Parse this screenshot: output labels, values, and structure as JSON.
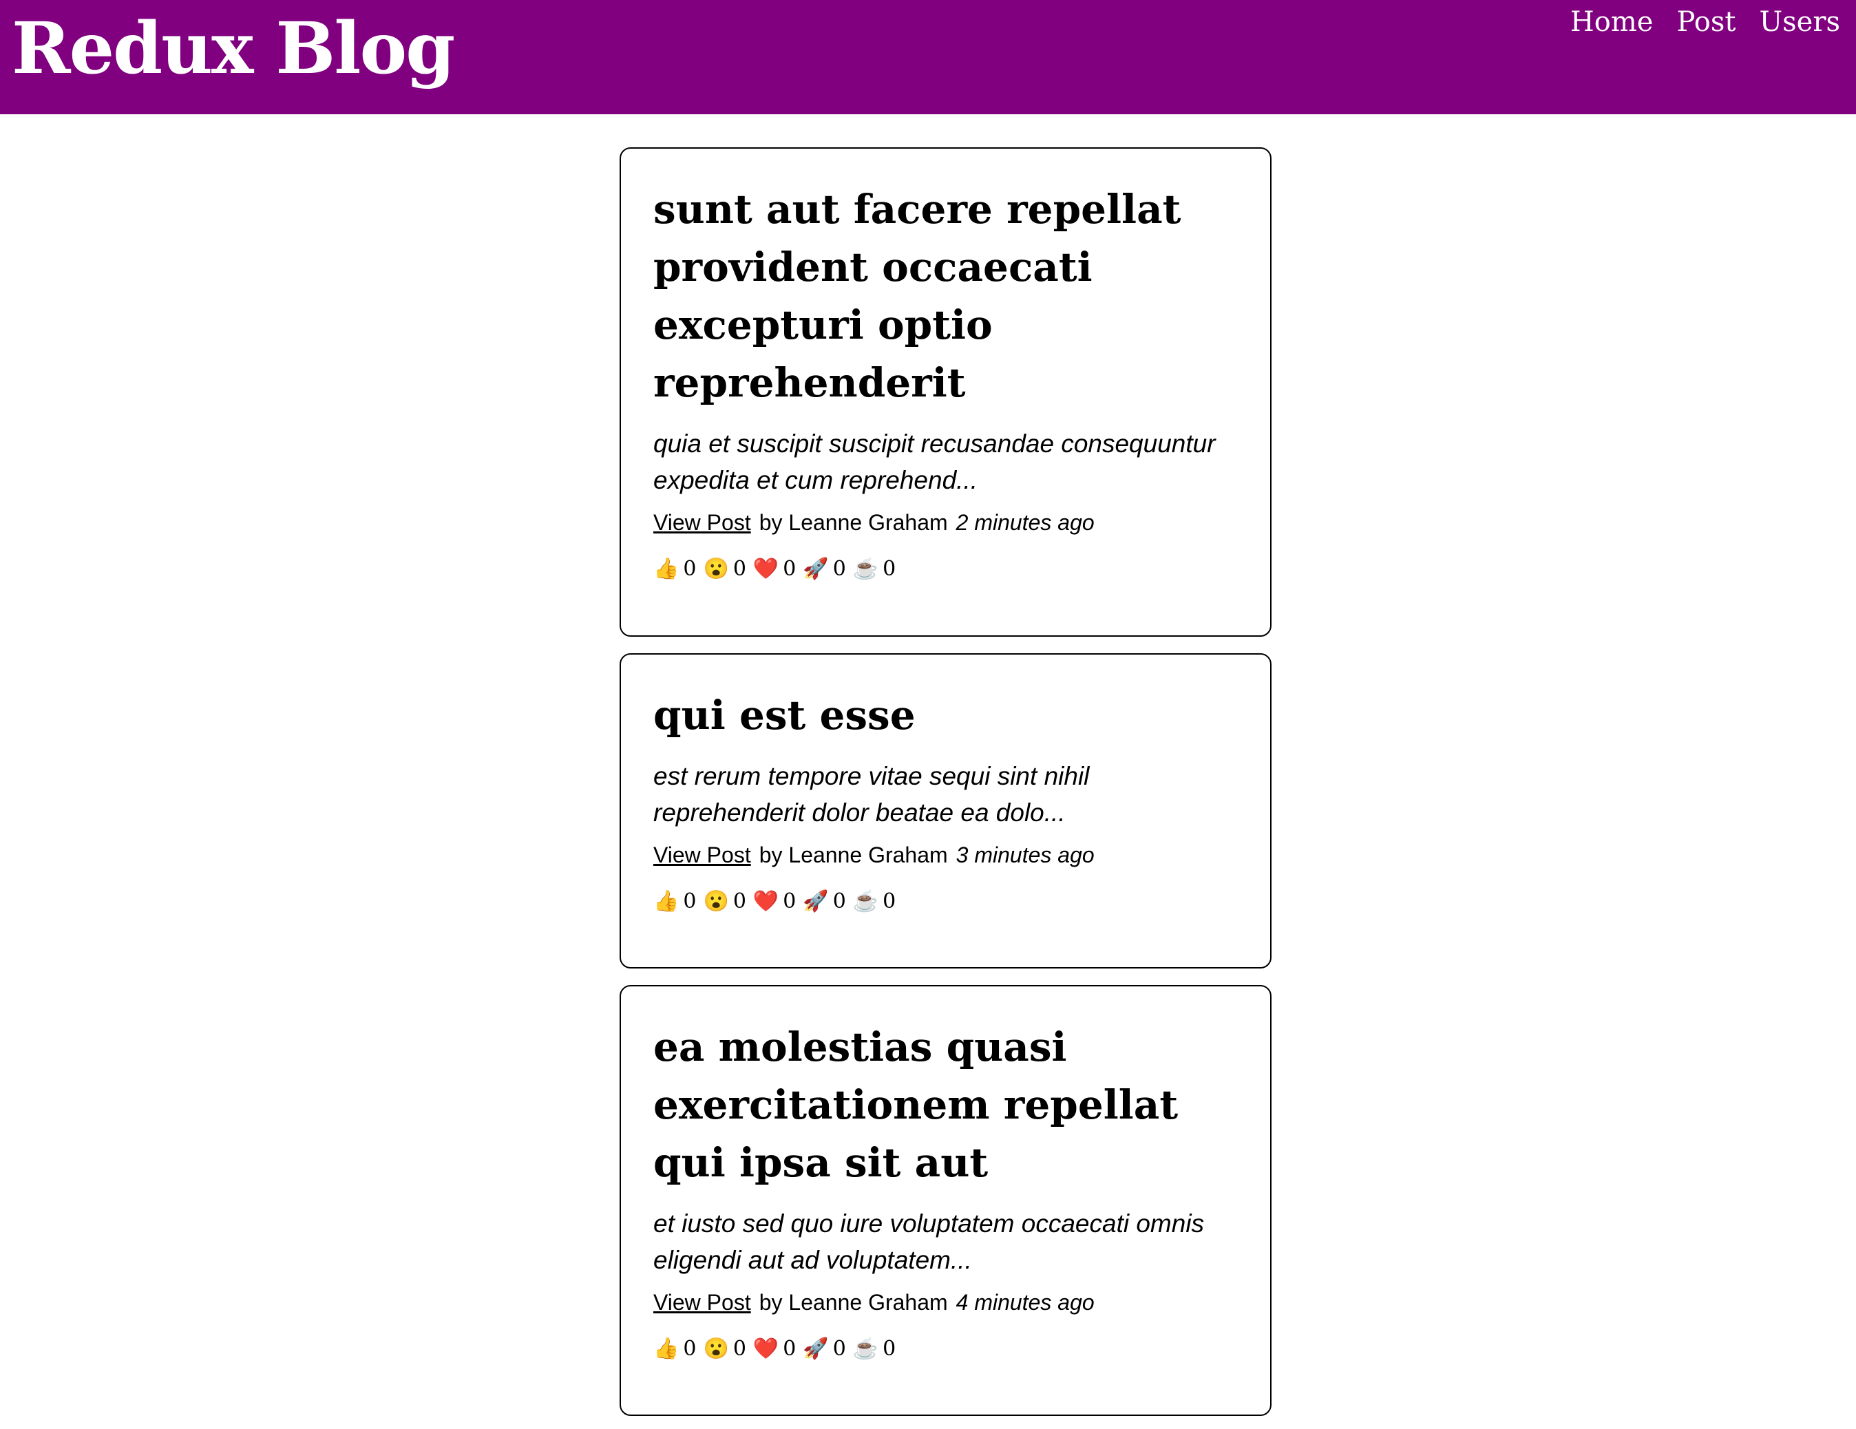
{
  "header": {
    "title": "Redux Blog",
    "nav": [
      "Home",
      "Post",
      "Users"
    ]
  },
  "posts": [
    {
      "title": "sunt aut facere repellat provident occaecati excepturi optio reprehenderit",
      "excerpt": "quia et suscipit suscipit recusandae consequuntur expedita et cum reprehend...",
      "link_label": "View Post",
      "author": "by Leanne Graham",
      "time": "2 minutes ago",
      "reactions": [
        {
          "icon": "thumbs-up",
          "emoji": "👍",
          "count": "0"
        },
        {
          "icon": "wow-face",
          "emoji": "😮",
          "count": "0"
        },
        {
          "icon": "heart",
          "emoji": "❤️",
          "count": "0"
        },
        {
          "icon": "rocket",
          "emoji": "🚀",
          "count": "0"
        },
        {
          "icon": "coffee",
          "emoji": "☕",
          "count": "0"
        }
      ]
    },
    {
      "title": "qui est esse",
      "excerpt": "est rerum tempore vitae sequi sint nihil reprehenderit dolor beatae ea dolo...",
      "link_label": "View Post",
      "author": "by Leanne Graham",
      "time": "3 minutes ago",
      "reactions": [
        {
          "icon": "thumbs-up",
          "emoji": "👍",
          "count": "0"
        },
        {
          "icon": "wow-face",
          "emoji": "😮",
          "count": "0"
        },
        {
          "icon": "heart",
          "emoji": "❤️",
          "count": "0"
        },
        {
          "icon": "rocket",
          "emoji": "🚀",
          "count": "0"
        },
        {
          "icon": "coffee",
          "emoji": "☕",
          "count": "0"
        }
      ]
    },
    {
      "title": "ea molestias quasi exercitationem repellat qui ipsa sit aut",
      "excerpt": "et iusto sed quo iure voluptatem occaecati omnis eligendi aut ad voluptatem...",
      "link_label": "View Post",
      "author": "by Leanne Graham",
      "time": "4 minutes ago",
      "reactions": [
        {
          "icon": "thumbs-up",
          "emoji": "👍",
          "count": "0"
        },
        {
          "icon": "wow-face",
          "emoji": "😮",
          "count": "0"
        },
        {
          "icon": "heart",
          "emoji": "❤️",
          "count": "0"
        },
        {
          "icon": "rocket",
          "emoji": "🚀",
          "count": "0"
        },
        {
          "icon": "coffee",
          "emoji": "☕",
          "count": "0"
        }
      ]
    }
  ],
  "colors": {
    "header_bg": "#800080",
    "header_text": "#ffffff",
    "card_border": "#000000"
  }
}
